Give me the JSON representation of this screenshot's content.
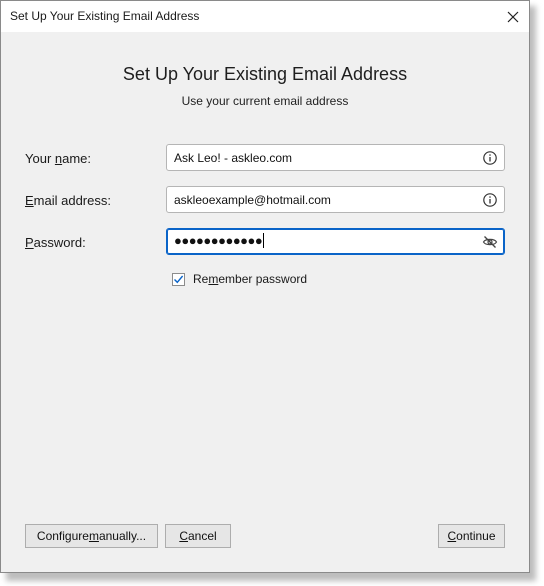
{
  "window": {
    "title": "Set Up Your Existing Email Address"
  },
  "header": {
    "title": "Set Up Your Existing Email Address",
    "subtitle": "Use your current email address"
  },
  "form": {
    "name": {
      "label_pre": "Your ",
      "label_ul": "n",
      "label_post": "ame:",
      "value": "Ask Leo! - askleo.com",
      "icon": "info-icon"
    },
    "email": {
      "label_pre": "",
      "label_ul": "E",
      "label_post": "mail address:",
      "value": "askleoexample@hotmail.com",
      "icon": "info-icon"
    },
    "password": {
      "label_pre": "",
      "label_ul": "P",
      "label_post": "assword:",
      "value": "●●●●●●●●●●●●",
      "icon": "eye-slash-icon"
    },
    "remember": {
      "checked": true,
      "label_pre": "Re",
      "label_ul": "m",
      "label_post": "ember password"
    }
  },
  "buttons": {
    "configure": {
      "pre": "Configure ",
      "ul": "m",
      "post": "anually..."
    },
    "cancel": {
      "pre": "",
      "ul": "C",
      "post": "ancel"
    },
    "continue": {
      "pre": "",
      "ul": "C",
      "post": "ontinue"
    }
  },
  "colors": {
    "focus": "#0a64c8",
    "dialog_bg": "#f0f0f0",
    "check": "#0a64c8"
  }
}
